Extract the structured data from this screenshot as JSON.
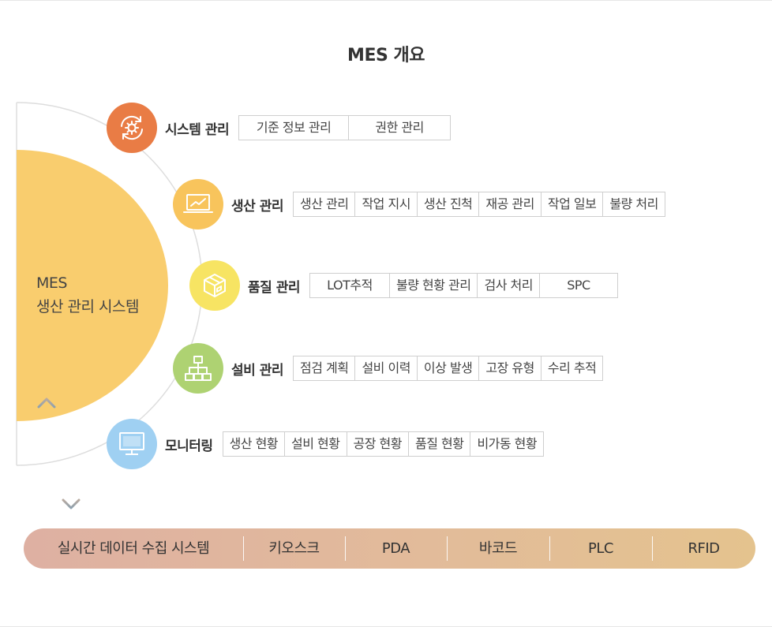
{
  "title": "MES 개요",
  "core": {
    "line1": "MES",
    "line2": "생산 관리 시스템"
  },
  "modules": [
    {
      "name": "시스템 관리",
      "icon": "gear-refresh-icon",
      "color": "#e97c45",
      "tags": [
        "기준 정보 관리",
        "권한 관리"
      ]
    },
    {
      "name": "생산 관리",
      "icon": "monitor-chart-icon",
      "color": "#f8c45c",
      "tags": [
        "생산 관리",
        "작업 지시",
        "생산 진척",
        "재공 관리",
        "작업 일보",
        "불량 처리"
      ]
    },
    {
      "name": "품질 관리",
      "icon": "box-icon",
      "color": "#f7e463",
      "tags": [
        "LOT추적",
        "불량 현황 관리",
        "검사 처리",
        "SPC"
      ]
    },
    {
      "name": "설비 관리",
      "icon": "hierarchy-icon",
      "color": "#aed272",
      "tags": [
        "점검 계획",
        "설비 이력",
        "이상 발생",
        "고장 유형",
        "수리 추적"
      ]
    },
    {
      "name": "모니터링",
      "icon": "desktop-icon",
      "color": "#9fd0f2",
      "tags": [
        "생산 현황",
        "설비 현황",
        "공장 현황",
        "품질 현황",
        "비가동 현황"
      ]
    }
  ],
  "collection_bar": {
    "title": "실시간 데이터 수집 시스템",
    "items": [
      "키오스크",
      "PDA",
      "바코드",
      "PLC",
      "RFID"
    ]
  },
  "colors": {
    "sun": "#f9cd6e",
    "arc": "#dddddd",
    "arrow_top": "#b0a39a",
    "arrow_bottom": "#8ea0ad"
  }
}
